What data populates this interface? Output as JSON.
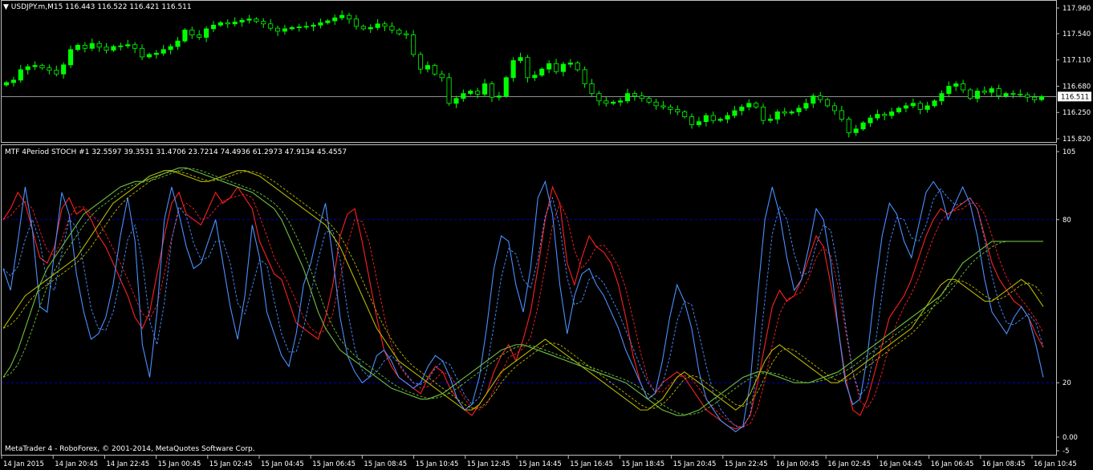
{
  "price_header": {
    "symbol": "USDJPY.m,M15",
    "values": "116.443 116.522 116.421 116.511"
  },
  "indicator_header": {
    "name": "MTF 4Period STOCH #1",
    "values": "32.5597 39.3531 31.4706 23.7214 74.4936 61.2973 47.9134 45.4557"
  },
  "copyright": "MetaTrader 4 - RoboForex, © 2001-2014, MetaQuotes Software Corp.",
  "colors": {
    "bull": "#00ff00",
    "bear": "#000000",
    "bg": "#000000",
    "grid": "#0000cc",
    "red": "#ff2020",
    "blue": "#4a90ff",
    "yellow": "#b8b800",
    "green": "#70c040"
  },
  "chart_data": [
    {
      "type": "candlestick",
      "ylim": [
        115.82,
        117.96
      ],
      "yticks": [
        "117.960",
        "117.540",
        "117.110",
        "116.680",
        "116.250",
        "115.820"
      ],
      "current_price": "116.511",
      "xticks": [
        "14 Jan 2015",
        "14 Jan 20:45",
        "14 Jan 22:45",
        "15 Jan 00:45",
        "15 Jan 02:45",
        "15 Jan 04:45",
        "15 Jan 06:45",
        "15 Jan 08:45",
        "15 Jan 10:45",
        "15 Jan 12:45",
        "15 Jan 14:45",
        "15 Jan 16:45",
        "15 Jan 18:45",
        "15 Jan 20:45",
        "15 Jan 22:45",
        "16 Jan 00:45",
        "16 Jan 02:45",
        "16 Jan 04:45",
        "16 Jan 06:45",
        "16 Jan 08:45",
        "16 Jan 10:45"
      ],
      "close": [
        116.74,
        116.78,
        116.95,
        117.0,
        117.02,
        116.98,
        116.94,
        116.88,
        117.03,
        117.28,
        117.35,
        117.3,
        117.38,
        117.32,
        117.27,
        117.33,
        117.34,
        117.36,
        117.3,
        117.16,
        117.2,
        117.22,
        117.28,
        117.33,
        117.42,
        117.6,
        117.52,
        117.48,
        117.62,
        117.68,
        117.72,
        117.7,
        117.73,
        117.76,
        117.78,
        117.74,
        117.7,
        117.63,
        117.58,
        117.62,
        117.64,
        117.65,
        117.66,
        117.68,
        117.72,
        117.75,
        117.8,
        117.84,
        117.78,
        117.66,
        117.62,
        117.64,
        117.7,
        117.66,
        117.6,
        117.54,
        117.52,
        117.2,
        116.96,
        117.02,
        116.88,
        116.82,
        116.4,
        116.48,
        116.56,
        116.6,
        116.55,
        116.72,
        116.5,
        116.52,
        116.82,
        117.1,
        117.15,
        116.82,
        116.86,
        116.96,
        117.05,
        116.92,
        117.04,
        117.06,
        116.95,
        116.72,
        116.56,
        116.44,
        116.4,
        116.42,
        116.44,
        116.56,
        116.52,
        116.48,
        116.42,
        116.36,
        116.34,
        116.3,
        116.26,
        116.18,
        116.05,
        116.1,
        116.2,
        116.12,
        116.14,
        116.2,
        116.28,
        116.34,
        116.4,
        116.34,
        116.12,
        116.14,
        116.26,
        116.24,
        116.26,
        116.32,
        116.4,
        116.52,
        116.46,
        116.36,
        116.28,
        116.14,
        115.92,
        115.98,
        116.08,
        116.16,
        116.22,
        116.2,
        116.26,
        116.32,
        116.36,
        116.4,
        116.3,
        116.36,
        116.44,
        116.56,
        116.68,
        116.72,
        116.62,
        116.48,
        116.6,
        116.58,
        116.64,
        116.52,
        116.56,
        116.55,
        116.54,
        116.5,
        116.46,
        116.51
      ],
      "open_prev_offset": "open equals previous close; see script"
    },
    {
      "type": "line",
      "ylim": [
        -5,
        105
      ],
      "yticks": [
        "105",
        "80",
        "20",
        "0.00",
        "-5"
      ],
      "levels": [
        80,
        20
      ],
      "series": [
        {
          "color": "red",
          "values": [
            80,
            84,
            90,
            86,
            76,
            66,
            64,
            70,
            84,
            88,
            82,
            84,
            80,
            74,
            70,
            64,
            58,
            52,
            44,
            40,
            46,
            60,
            74,
            86,
            90,
            82,
            80,
            78,
            84,
            90,
            86,
            88,
            92,
            88,
            84,
            72,
            66,
            60,
            58,
            50,
            42,
            40,
            38,
            36,
            44,
            56,
            74,
            82,
            84,
            72,
            58,
            44,
            32,
            26,
            22,
            20,
            18,
            16,
            22,
            26,
            24,
            18,
            14,
            10,
            8,
            12,
            16,
            24,
            30,
            34,
            28,
            36,
            46,
            62,
            80,
            92,
            86,
            64,
            56,
            66,
            74,
            70,
            68,
            64,
            56,
            44,
            30,
            20,
            14,
            16,
            20,
            22,
            24,
            22,
            18,
            14,
            10,
            8,
            6,
            4,
            3,
            4,
            8,
            20,
            34,
            48,
            54,
            50,
            52,
            58,
            66,
            74,
            70,
            56,
            40,
            22,
            10,
            8,
            14,
            24,
            34,
            44,
            48,
            52,
            58,
            66,
            74,
            80,
            84,
            82,
            84,
            86,
            88,
            84,
            74,
            64,
            58,
            54,
            50,
            48,
            44,
            38,
            33
          ]
        },
        {
          "color": "blue",
          "values": [
            62,
            54,
            72,
            92,
            76,
            48,
            46,
            68,
            90,
            82,
            60,
            46,
            36,
            38,
            44,
            56,
            74,
            88,
            72,
            34,
            22,
            46,
            80,
            92,
            82,
            70,
            62,
            64,
            72,
            80,
            64,
            48,
            36,
            52,
            78,
            66,
            46,
            38,
            30,
            26,
            38,
            56,
            64,
            76,
            86,
            66,
            44,
            30,
            24,
            20,
            22,
            30,
            32,
            28,
            22,
            20,
            18,
            20,
            26,
            30,
            28,
            22,
            14,
            10,
            12,
            22,
            40,
            62,
            74,
            72,
            56,
            46,
            62,
            88,
            94,
            82,
            56,
            38,
            52,
            60,
            62,
            56,
            52,
            46,
            40,
            32,
            26,
            20,
            14,
            16,
            28,
            44,
            56,
            50,
            40,
            24,
            14,
            10,
            6,
            4,
            2,
            4,
            20,
            52,
            80,
            92,
            82,
            66,
            54,
            58,
            70,
            84,
            80,
            64,
            40,
            20,
            12,
            14,
            30,
            54,
            74,
            86,
            82,
            72,
            66,
            78,
            90,
            94,
            90,
            80,
            86,
            92,
            86,
            74,
            58,
            46,
            42,
            38,
            44,
            48,
            44,
            34,
            22
          ]
        },
        {
          "color": "yellow",
          "values": [
            40,
            44,
            48,
            52,
            54,
            56,
            58,
            60,
            62,
            64,
            66,
            70,
            74,
            78,
            82,
            86,
            88,
            90,
            92,
            94,
            96,
            97,
            98,
            98,
            97,
            96,
            95,
            94,
            94,
            95,
            96,
            97,
            98,
            98,
            97,
            96,
            94,
            92,
            90,
            88,
            86,
            84,
            82,
            80,
            78,
            74,
            70,
            64,
            58,
            52,
            46,
            40,
            36,
            32,
            28,
            26,
            24,
            22,
            20,
            18,
            16,
            14,
            12,
            10,
            10,
            12,
            16,
            20,
            24,
            26,
            28,
            30,
            32,
            34,
            36,
            34,
            32,
            30,
            28,
            26,
            24,
            22,
            20,
            18,
            16,
            14,
            12,
            10,
            10,
            12,
            14,
            18,
            22,
            24,
            22,
            20,
            18,
            16,
            14,
            12,
            10,
            12,
            16,
            22,
            28,
            32,
            34,
            32,
            30,
            28,
            26,
            24,
            22,
            20,
            20,
            22,
            24,
            26,
            28,
            30,
            32,
            34,
            36,
            38,
            40,
            44,
            48,
            52,
            56,
            58,
            58,
            56,
            54,
            52,
            50,
            50,
            52,
            54,
            56,
            58,
            56,
            52,
            48
          ]
        },
        {
          "color": "green",
          "values": [
            22,
            26,
            32,
            40,
            48,
            56,
            62,
            66,
            70,
            74,
            78,
            82,
            84,
            86,
            88,
            90,
            92,
            93,
            94,
            94,
            95,
            96,
            97,
            98,
            99,
            99,
            98,
            97,
            96,
            95,
            94,
            93,
            92,
            91,
            90,
            88,
            86,
            84,
            80,
            74,
            68,
            62,
            54,
            46,
            40,
            36,
            32,
            30,
            28,
            26,
            24,
            22,
            20,
            18,
            17,
            16,
            15,
            14,
            14,
            15,
            16,
            18,
            20,
            22,
            24,
            26,
            28,
            30,
            32,
            33,
            34,
            34,
            33,
            32,
            31,
            30,
            29,
            28,
            27,
            26,
            25,
            24,
            23,
            22,
            21,
            20,
            18,
            16,
            14,
            12,
            10,
            9,
            8,
            8,
            9,
            10,
            12,
            14,
            16,
            18,
            20,
            22,
            23,
            24,
            24,
            23,
            22,
            21,
            20,
            20,
            20,
            21,
            22,
            23,
            24,
            26,
            28,
            30,
            32,
            34,
            36,
            38,
            40,
            42,
            44,
            46,
            48,
            50,
            52,
            56,
            60,
            64,
            66,
            68,
            70,
            72,
            72,
            72,
            72,
            72,
            72,
            72,
            72
          ]
        }
      ]
    }
  ]
}
